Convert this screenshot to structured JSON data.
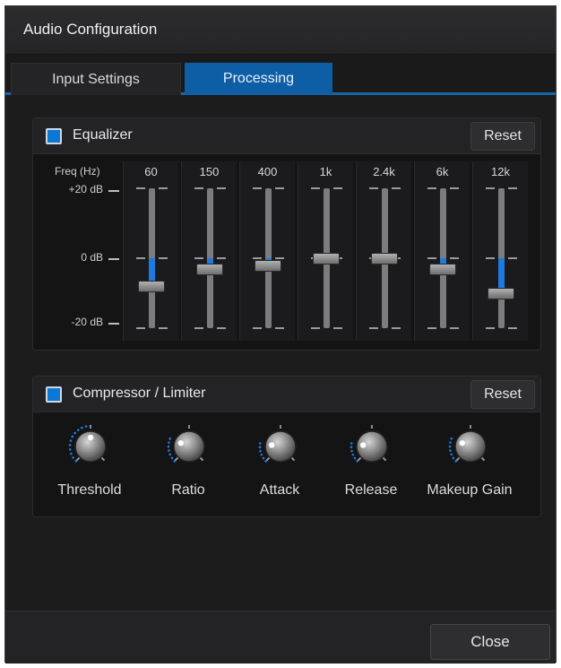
{
  "window": {
    "title": "Audio Configuration"
  },
  "tabs": [
    {
      "label": "Input Settings",
      "active": false
    },
    {
      "label": "Processing",
      "active": true
    }
  ],
  "equalizer": {
    "title": "Equalizer",
    "enabled": true,
    "reset_label": "Reset",
    "freq_label": "Freq (Hz)",
    "db_labels": [
      "+20 dB",
      "0 dB",
      "-20 dB"
    ],
    "db_range": [
      -20,
      20
    ],
    "bands": [
      {
        "label": "60",
        "gain_db": -8
      },
      {
        "label": "150",
        "gain_db": -3
      },
      {
        "label": "400",
        "gain_db": -2
      },
      {
        "label": "1k",
        "gain_db": 0
      },
      {
        "label": "2.4k",
        "gain_db": 0
      },
      {
        "label": "6k",
        "gain_db": -3
      },
      {
        "label": "12k",
        "gain_db": -10
      }
    ]
  },
  "compressor": {
    "title": "Compressor / Limiter",
    "enabled": true,
    "reset_label": "Reset",
    "knobs": [
      {
        "label": "Threshold",
        "value": 0.5
      },
      {
        "label": "Ratio",
        "value": 0.25
      },
      {
        "label": "Attack",
        "value": 0.2
      },
      {
        "label": "Release",
        "value": 0.2
      },
      {
        "label": "Makeup Gain",
        "value": 0.25
      }
    ]
  },
  "footer": {
    "close_label": "Close"
  },
  "colors": {
    "accent": "#0e5ea6",
    "fill": "#1c7be0",
    "background": "#1c1c1d"
  }
}
